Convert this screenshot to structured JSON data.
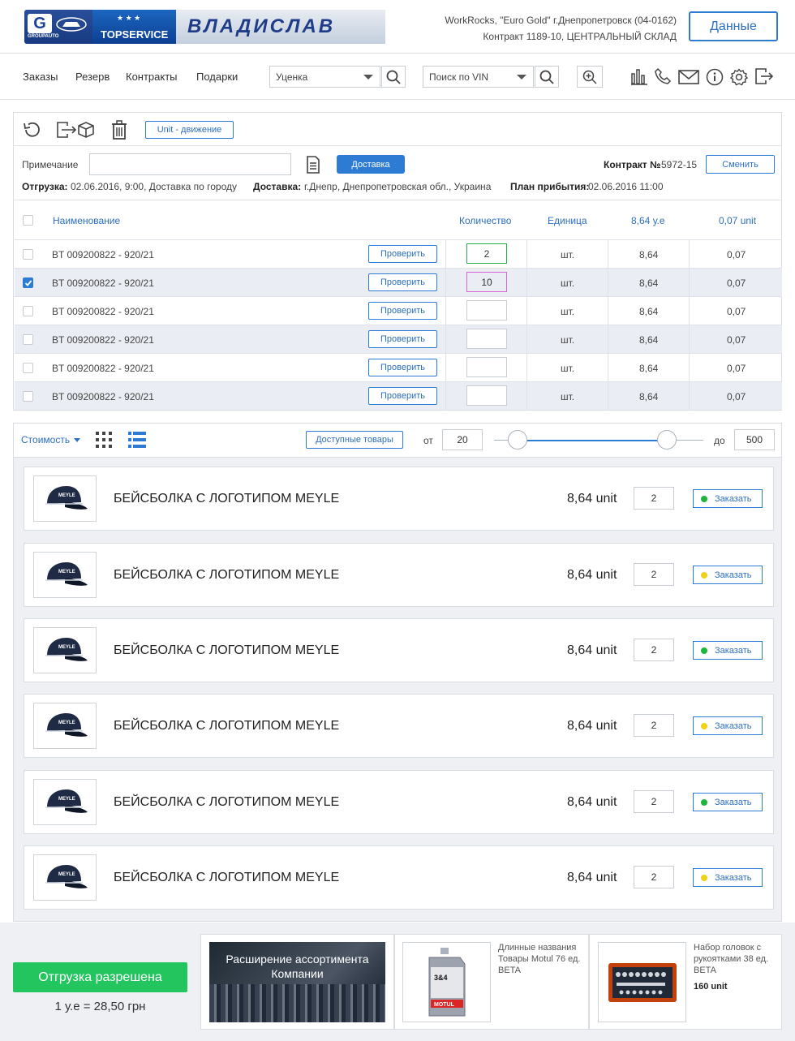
{
  "brand": {
    "name": "ВЛАДИСЛАВ",
    "sub_logo": "TOPSERVICE",
    "group_logo": "GROUPAUTO"
  },
  "account": {
    "line1": "WorkRocks, \"Euro Gold\" г.Днепропетровск (04-0162)",
    "line2": "Контракт 1189-10, ЦЕНТРАЛЬНЫЙ СКЛАД",
    "button": "Данные"
  },
  "nav": {
    "items": [
      "Заказы",
      "Резерв",
      "Контракты",
      "Подарки"
    ],
    "select1": "Уценка",
    "select2": "Поиск по VIN"
  },
  "toolbar": {
    "unit_button": "Unit - движение"
  },
  "order": {
    "note_label": "Примечание",
    "note_value": "",
    "delivery_button": "Доставка",
    "contract_label": "Контракт №",
    "contract_number": "5972-15",
    "change_button": "Сменить",
    "ship_label": "Отгрузка:",
    "ship_value": "02.06.2016, 9:00, Доставка по городу",
    "delivery_label": "Доставка:",
    "delivery_value": "г.Днепр, Днепропетровская обл., Украина",
    "arrival_label": "План прибытия:",
    "arrival_value": "02.06.2016 11:00"
  },
  "table": {
    "headers": {
      "name": "Наименование",
      "qty": "Количество",
      "unit": "Единица",
      "price": "8,64 у.е",
      "unitprice": "0,07 unit"
    },
    "check_label": "Проверить",
    "rows": [
      {
        "name": "BT 009200822 - 920/21",
        "qty": "2",
        "unit": "шт.",
        "price": "8,64",
        "unitprice": "0,07",
        "checked": false
      },
      {
        "name": "BT 009200822 - 920/21",
        "qty": "10",
        "unit": "шт.",
        "price": "8,64",
        "unitprice": "0,07",
        "checked": true
      },
      {
        "name": "BT 009200822 - 920/21",
        "qty": "",
        "unit": "шт.",
        "price": "8,64",
        "unitprice": "0,07",
        "checked": false
      },
      {
        "name": "BT 009200822 - 920/21",
        "qty": "",
        "unit": "шт.",
        "price": "8,64",
        "unitprice": "0,07",
        "checked": false
      },
      {
        "name": "BT 009200822 - 920/21",
        "qty": "",
        "unit": "шт.",
        "price": "8,64",
        "unitprice": "0,07",
        "checked": false
      },
      {
        "name": "BT 009200822 - 920/21",
        "qty": "",
        "unit": "шт.",
        "price": "8,64",
        "unitprice": "0,07",
        "checked": false
      }
    ]
  },
  "filter": {
    "sort_label": "Стоимость",
    "available_button": "Доступные товары",
    "from_label": "от",
    "from_value": "20",
    "to_label": "до",
    "to_value": "500"
  },
  "products": {
    "order_label": "Заказать",
    "items": [
      {
        "title": "БЕЙСБОЛКА С ЛОГОТИПОМ MEYLE",
        "price": "8,64 unit",
        "qty": "2",
        "status_color": "#1fb53a"
      },
      {
        "title": "БЕЙСБОЛКА С ЛОГОТИПОМ MEYLE",
        "price": "8,64 unit",
        "qty": "2",
        "status_color": "#f0d11a"
      },
      {
        "title": "БЕЙСБОЛКА С ЛОГОТИПОМ MEYLE",
        "price": "8,64 unit",
        "qty": "2",
        "status_color": "#1fb53a"
      },
      {
        "title": "БЕЙСБОЛКА С ЛОГОТИПОМ MEYLE",
        "price": "8,64 unit",
        "qty": "2",
        "status_color": "#f0d11a"
      },
      {
        "title": "БЕЙСБОЛКА С ЛОГОТИПОМ MEYLE",
        "price": "8,64 unit",
        "qty": "2",
        "status_color": "#1fb53a"
      },
      {
        "title": "БЕЙСБОЛКА С ЛОГОТИПОМ MEYLE",
        "price": "8,64 unit",
        "qty": "2",
        "status_color": "#f0d11a"
      }
    ]
  },
  "footer": {
    "shipment_button": "Отгрузка разрешена",
    "rate": "1 у.е = 28,50 грн",
    "promo1": "Расширение ассортимента Компании",
    "promo2": "Длинные названия Товары Motul 76 ед. BETA",
    "promo3_title": "Набор головок с рукоятками 38 ед. BETA",
    "promo3_price": "160 unit"
  },
  "colors": {
    "accent": "#2d7bd3",
    "green": "#22c55e",
    "row_alt": "#eaedf4"
  }
}
